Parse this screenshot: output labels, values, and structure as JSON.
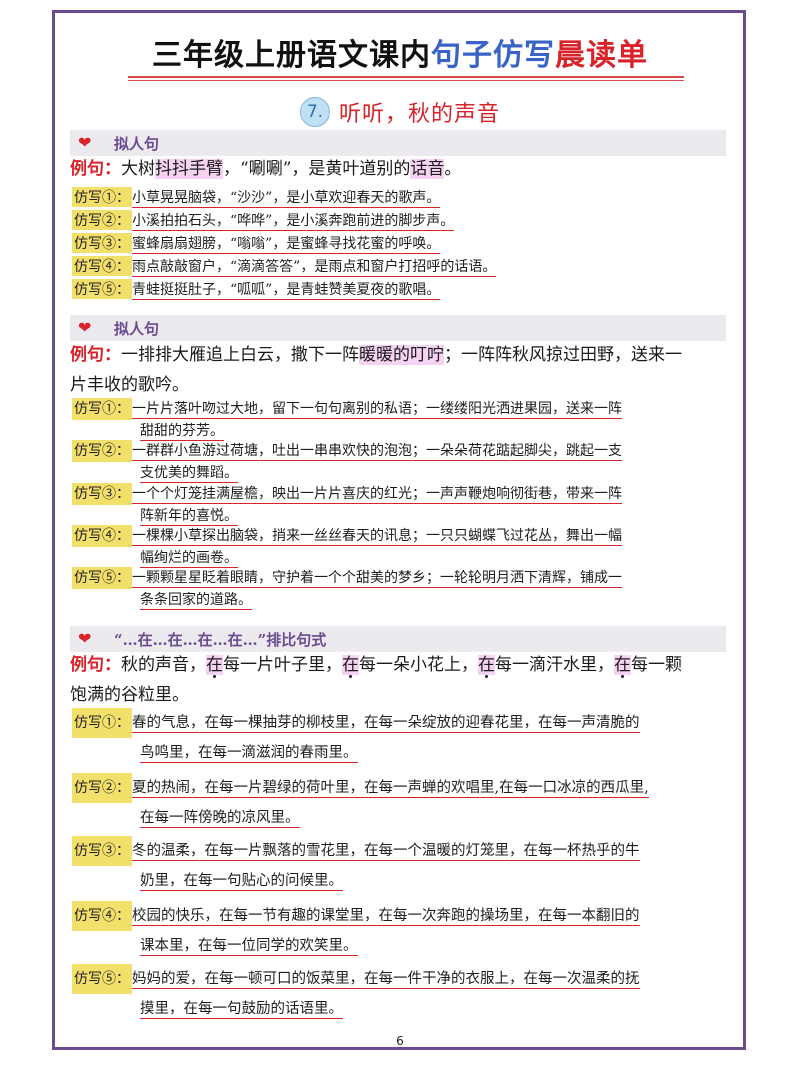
{
  "header": {
    "title_part1": "三年级上册语文课内",
    "title_part2": "句子仿写",
    "title_part3": "晨读单",
    "lesson_number": "7.",
    "lesson_title": "听听，秋的声音"
  },
  "sections": [
    {
      "heading": "拟人句",
      "example_label": "例句：",
      "example": {
        "p1": "大树",
        "hl1": "抖抖手臂",
        "p2": "，“唰唰”，是黄叶道别的",
        "hl2": "话音",
        "p3": "。"
      },
      "imitations": [
        {
          "tag": "仿写①：",
          "text": "小草晃晃脑袋，“沙沙”，是小草欢迎春天的歌声。"
        },
        {
          "tag": "仿写②：",
          "text": "小溪拍拍石头，“哗哗”，是小溪奔跑前进的脚步声。"
        },
        {
          "tag": "仿写③：",
          "text": "蜜蜂扇扇翅膀，“嗡嗡”，是蜜蜂寻找花蜜的呼唤。"
        },
        {
          "tag": "仿写④：",
          "text": "雨点敲敲窗户，“滴滴答答”，是雨点和窗户打招呼的话语。"
        },
        {
          "tag": "仿写⑤：",
          "text": "青蛙挺挺肚子，“呱呱”，是青蛙赞美夏夜的歌唱。"
        }
      ]
    },
    {
      "heading": "拟人句",
      "example_label": "例句：",
      "example": {
        "p1": "一排排大雁追上白云，撒下一阵",
        "hl1": "暖暖的叮咛",
        "p2": "；一阵阵秋风掠过田野，送来一",
        "line2": "片丰收的歌吟。"
      },
      "imitations": [
        {
          "tag": "仿写①：",
          "line1": "一片片落叶吻过大地，留下一句句离别的私语；一缕缕阳光洒进果园，送来一阵",
          "line2": "甜甜的芬芳。"
        },
        {
          "tag": "仿写②：",
          "line1": "一群群小鱼游过荷塘，吐出一串串欢快的泡泡；一朵朵荷花踮起脚尖，跳起一支",
          "line2": "支优美的舞蹈。"
        },
        {
          "tag": "仿写③：",
          "line1": "一个个灯笼挂满屋檐，映出一片片喜庆的红光；一声声鞭炮响彻街巷，带来一阵",
          "line2": "阵新年的喜悦。"
        },
        {
          "tag": "仿写④：",
          "line1": "一棵棵小草探出脑袋，捎来一丝丝春天的讯息；一只只蝴蝶飞过花丛，舞出一幅",
          "line2": "幅绚烂的画卷。"
        },
        {
          "tag": "仿写⑤：",
          "line1": "一颗颗星星眨着眼睛，守护着一个个甜美的梦乡；一轮轮明月洒下清辉，铺成一",
          "line2": "条条回家的道路。"
        }
      ]
    },
    {
      "heading": "“…在…在…在…在…”排比句式",
      "example_label": "例句：",
      "example": {
        "p1": "秋的声音，",
        "z": "在",
        "s1": "每一片叶子里，",
        "s2": "每一朵小花上，",
        "s3": "每一滴汗水里，",
        "s4": "每一颗",
        "line2": "饱满的谷粒里。"
      },
      "imitations": [
        {
          "tag": "仿写①：",
          "line1": "春的气息，在每一棵抽芽的柳枝里，在每一朵绽放的迎春花里，在每一声清脆的",
          "line2": "鸟鸣里，在每一滴滋润的春雨里。"
        },
        {
          "tag": "仿写②：",
          "line1": "夏的热闹，在每一片碧绿的荷叶里，在每一声蝉的欢唱里,在每一口冰凉的西瓜里,",
          "line2": "在每一阵傍晚的凉风里。"
        },
        {
          "tag": "仿写③：",
          "line1": "冬的温柔，在每一片飘落的雪花里，在每一个温暖的灯笼里，在每一杯热乎的牛",
          "line2": "奶里，在每一句贴心的问候里。"
        },
        {
          "tag": "仿写④：",
          "line1": "校园的快乐，在每一节有趣的课堂里，在每一次奔跑的操场里，在每一本翻旧的",
          "line2": "课本里，在每一位同学的欢笑里。"
        },
        {
          "tag": "仿写⑤：",
          "line1": "妈妈的爱，在每一顿可口的饭菜里，在每一件干净的衣服上，在每一次温柔的抚",
          "line2": "摸里，在每一句鼓励的话语里。"
        }
      ]
    }
  ],
  "page_number": "6"
}
